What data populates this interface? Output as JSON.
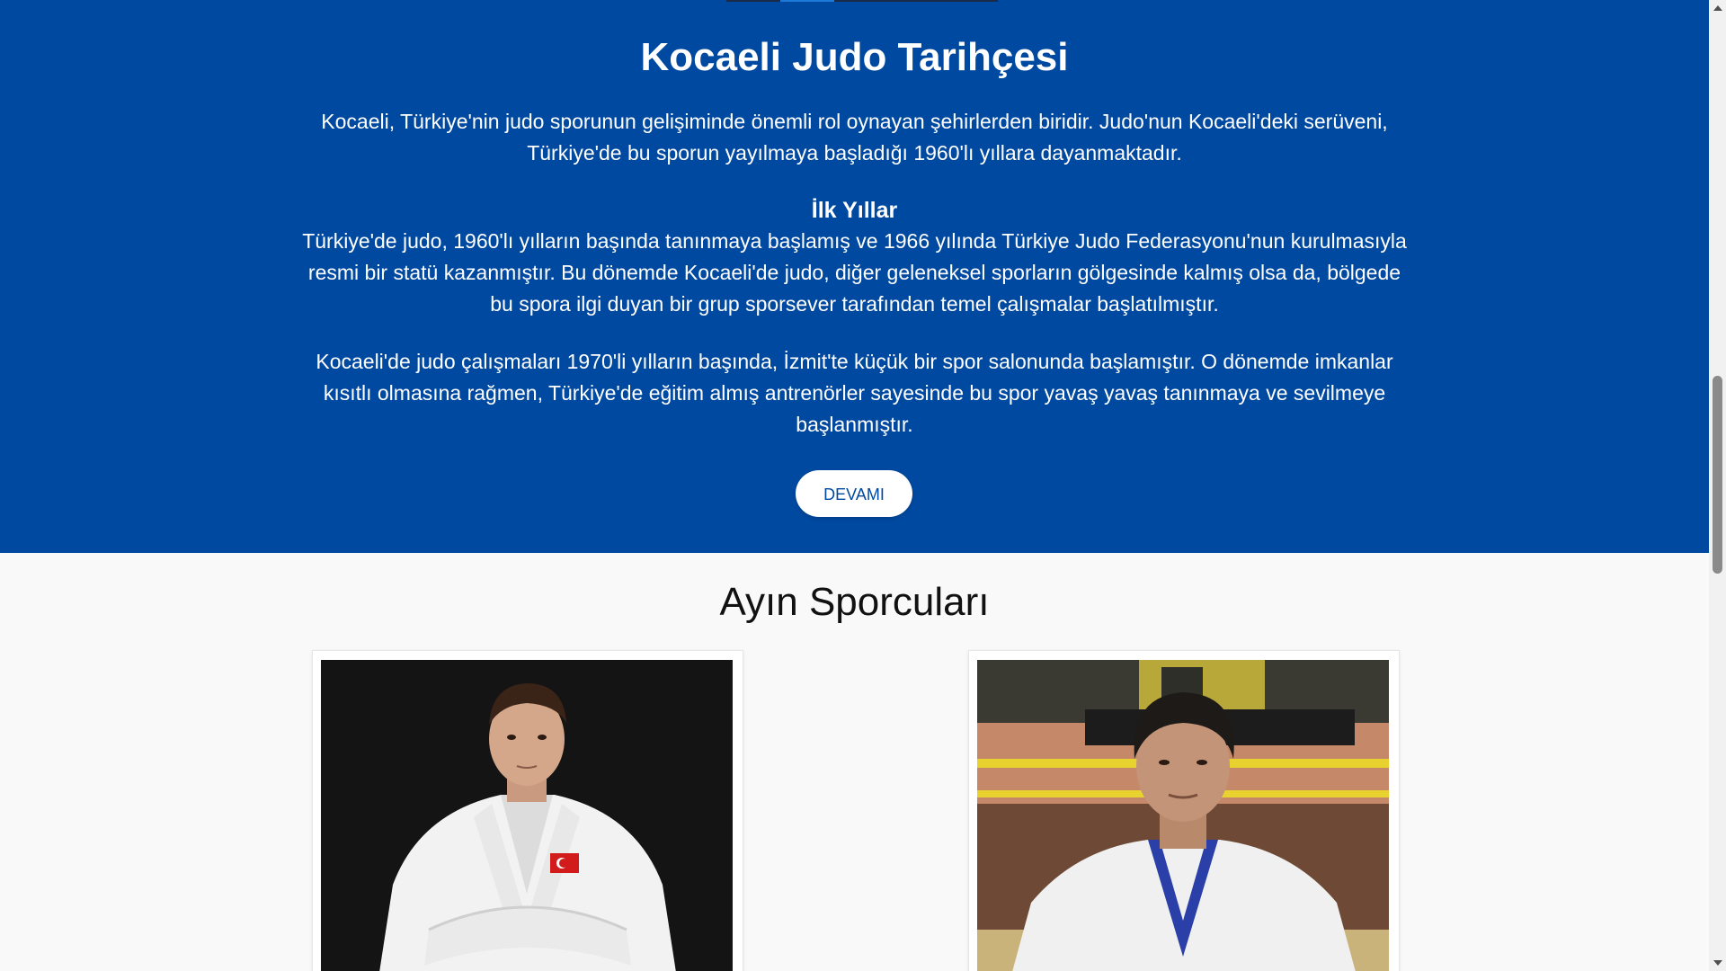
{
  "history": {
    "title": "Kocaeli Judo Tarihçesi",
    "intro": "Kocaeli, Türkiye'nin judo sporunun gelişiminde önemli rol oynayan şehirlerden biridir. Judo'nun Kocaeli'deki serüveni, Türkiye'de bu sporun yayılmaya başladığı 1960'lı yıllara dayanmaktadır.",
    "subheading": "İlk Yıllar",
    "paragraph1": "Türkiye'de judo, 1960'lı yılların başında tanınmaya başlamış ve 1966 yılında Türkiye Judo Federasyonu'nun kurulmasıyla resmi bir statü kazanmıştır. Bu dönemde Kocaeli'de judo, diğer geleneksel sporların gölgesinde kalmış olsa da, bölgede bu spora ilgi duyan bir grup sporsever tarafından temel çalışmalar başlatılmıştır.",
    "paragraph2": "Kocaeli'de judo çalışmaları 1970'li yılların başında, İzmit'te küçük bir spor salonunda başlamıştır. O dönemde imkanlar kısıtlı olmasına rağmen, Türkiye'de eğitim almış antrenörler sayesinde bu spor yavaş yavaş tanınmaya ve sevilmeye başlanmıştır.",
    "more_button": "DEVAMI",
    "active_slide": 2
  },
  "athletes": {
    "title": "Ayın Sporcuları",
    "cards": [
      {
        "photo": "athlete-photo-1"
      },
      {
        "photo": "athlete-photo-2"
      }
    ]
  },
  "colors": {
    "primary": "#0049a0",
    "background": "#f9f9f9",
    "button_bg": "#ffffff"
  }
}
